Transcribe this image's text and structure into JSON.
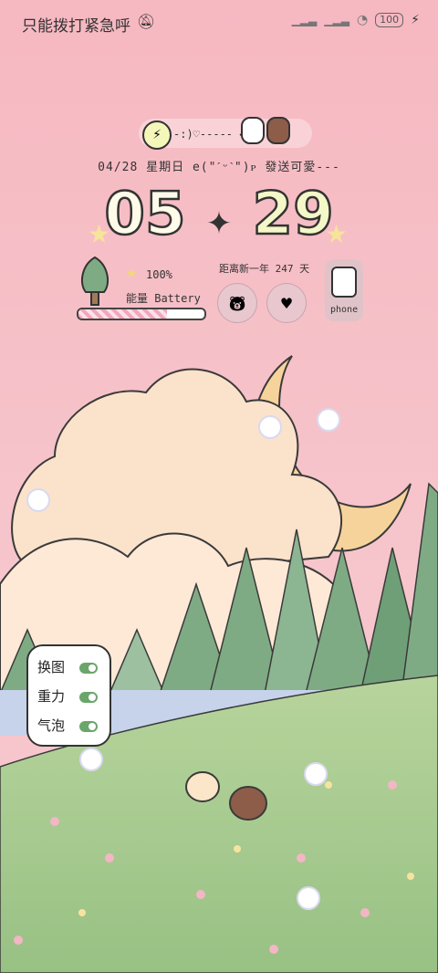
{
  "status_bar": {
    "left_text": "只能拨打紧急呼",
    "battery": "100"
  },
  "widget": {
    "mini_text": "-:)♡----- ⇠",
    "date_line": "04/28  星期日  e(\"ˊᵕˋ\")ᴘ 發送可愛---",
    "clock_hours": "05",
    "clock_minutes": "29",
    "battery_percent": "100%",
    "battery_label": "能量 Battery",
    "battery_level": 0.7,
    "countdown": "距离新一年 247 天",
    "phone_label": "phone"
  },
  "panel": {
    "items": [
      {
        "label": "换图",
        "on": true
      },
      {
        "label": "重力",
        "on": true
      },
      {
        "label": "气泡",
        "on": true
      }
    ]
  }
}
